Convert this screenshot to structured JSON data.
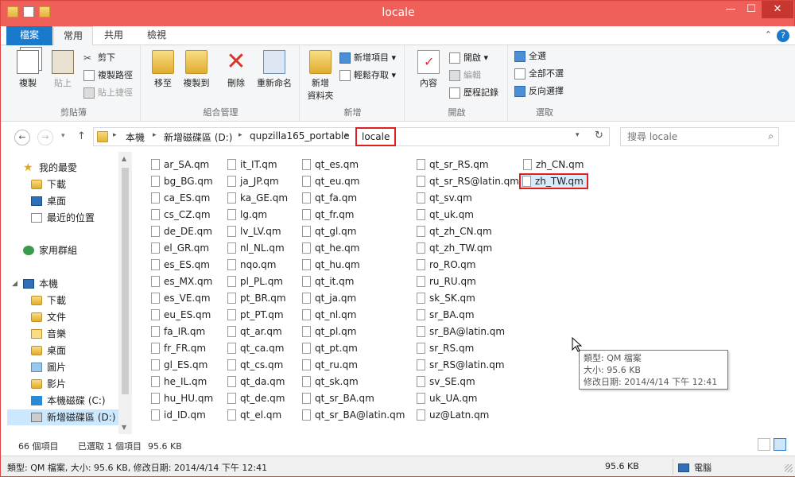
{
  "window": {
    "title": "locale",
    "minimize": "—",
    "maximize": "☐",
    "close": "✕"
  },
  "ribbon_tabs": {
    "file": "檔案",
    "home": "常用",
    "share": "共用",
    "view": "檢視",
    "help": "?",
    "collapse": "⌃"
  },
  "ribbon": {
    "clipboard": {
      "label": "剪貼簿",
      "copy": "複製",
      "paste": "貼上",
      "cut": "剪下",
      "copy_path": "複製路徑",
      "paste_shortcut": "貼上捷徑"
    },
    "organize": {
      "label": "組合管理",
      "move_to": "移至",
      "copy_to": "複製到",
      "delete": "刪除",
      "rename": "重新命名"
    },
    "new": {
      "label": "新增",
      "new_folder_line1": "新增",
      "new_folder_line2": "資料夾",
      "new_item": "新增項目",
      "easy_access": "輕鬆存取"
    },
    "open": {
      "label": "開啟",
      "properties": "內容",
      "open": "開啟",
      "edit": "編輯",
      "history": "歷程記錄"
    },
    "select": {
      "label": "選取",
      "select_all": "全選",
      "select_none": "全部不選",
      "invert": "反向選擇"
    }
  },
  "address": {
    "crumbs": [
      "本機",
      "新增磁碟區 (D:)",
      "qupzilla165_portable",
      "locale"
    ],
    "search_placeholder": "搜尋 locale"
  },
  "nav_pane": {
    "favorites": "我的最愛",
    "downloads": "下載",
    "desktop": "桌面",
    "recent": "最近的位置",
    "homegroup": "家用群組",
    "this_pc": "本機",
    "pc_downloads": "下載",
    "documents": "文件",
    "music": "音樂",
    "pc_desktop": "桌面",
    "pictures": "圖片",
    "videos": "影片",
    "drive_c": "本機磁碟 (C:)",
    "drive_d": "新增磁碟區 (D:)"
  },
  "files": {
    "col1": [
      "ar_SA.qm",
      "bg_BG.qm",
      "ca_ES.qm",
      "cs_CZ.qm",
      "de_DE.qm",
      "el_GR.qm",
      "es_ES.qm",
      "es_MX.qm",
      "es_VE.qm",
      "eu_ES.qm",
      "fa_IR.qm",
      "fr_FR.qm",
      "gl_ES.qm",
      "he_IL.qm",
      "hu_HU.qm",
      "id_ID.qm"
    ],
    "col2": [
      "it_IT.qm",
      "ja_JP.qm",
      "ka_GE.qm",
      "lg.qm",
      "lv_LV.qm",
      "nl_NL.qm",
      "nqo.qm",
      "pl_PL.qm",
      "pt_BR.qm",
      "pt_PT.qm",
      "qt_ar.qm",
      "qt_ca.qm",
      "qt_cs.qm",
      "qt_da.qm",
      "qt_de.qm",
      "qt_el.qm"
    ],
    "col3": [
      "qt_es.qm",
      "qt_eu.qm",
      "qt_fa.qm",
      "qt_fr.qm",
      "qt_gl.qm",
      "qt_he.qm",
      "qt_hu.qm",
      "qt_it.qm",
      "qt_ja.qm",
      "qt_nl.qm",
      "qt_pl.qm",
      "qt_pt.qm",
      "qt_ru.qm",
      "qt_sk.qm",
      "qt_sr_BA.qm",
      "qt_sr_BA@latin.qm"
    ],
    "col4": [
      "qt_sr_RS.qm",
      "qt_sr_RS@latin.qm",
      "qt_sv.qm",
      "qt_uk.qm",
      "qt_zh_CN.qm",
      "qt_zh_TW.qm",
      "ro_RO.qm",
      "ru_RU.qm",
      "sk_SK.qm",
      "sr_BA.qm",
      "sr_BA@latin.qm",
      "sr_RS.qm",
      "sr_RS@latin.qm",
      "sv_SE.qm",
      "uk_UA.qm",
      "uz@Latn.qm"
    ],
    "col5": [
      "zh_CN.qm",
      "zh_TW.qm"
    ]
  },
  "tooltip": {
    "type": "類型: QM 檔案",
    "size": "大小: 95.6 KB",
    "modified": "修改日期: 2014/4/14 下午 12:41"
  },
  "status": {
    "count": "66 個項目",
    "selected": "已選取 1 個項目",
    "selected_size": "95.6 KB"
  },
  "infobar": {
    "details": "類型: QM 檔案, 大小: 95.6 KB, 修改日期: 2014/4/14 下午 12:41",
    "size": "95.6 KB",
    "location": "電腦"
  }
}
